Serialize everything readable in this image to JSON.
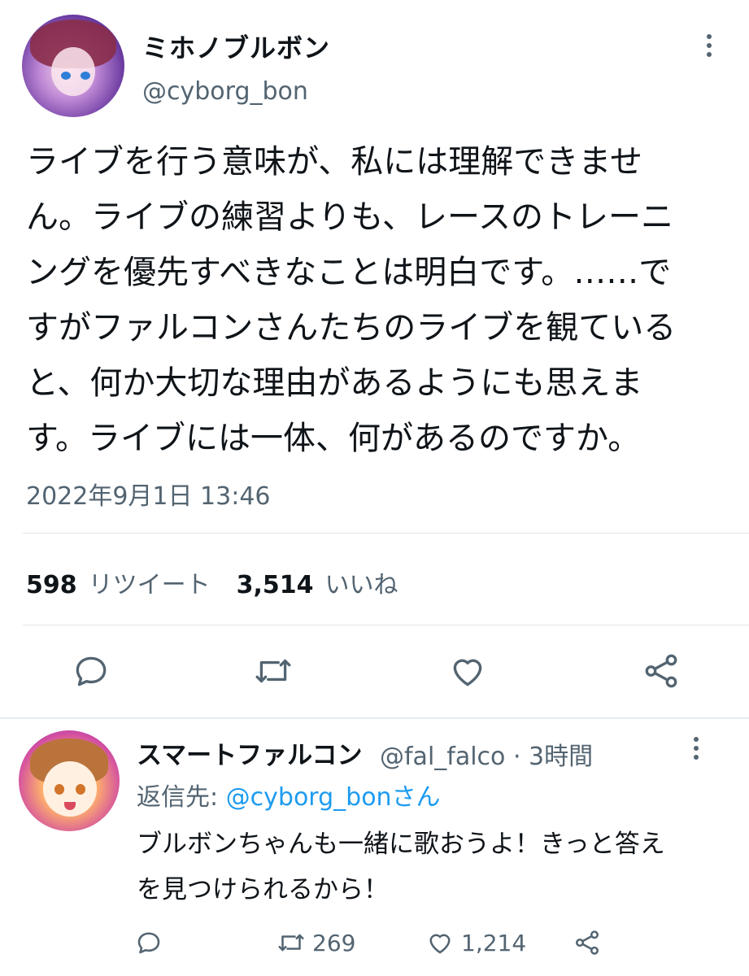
{
  "tweet": {
    "display_name": "ミホノブルボン",
    "handle": "@cyborg_bon",
    "text_lines": [
      "ライブを行う意味が、私には理解できませ",
      "ん。ライブの練習よりも、レースのトレーニ",
      "ングを優先すべきなことは明白です。……で",
      "すがファルコンさんたちのライブを観ている",
      "と、何か大切な理由があるようにも思えま",
      "す。ライブには一体、何があるのですか。"
    ],
    "timestamp": "2022年9月1日 13:46",
    "retweet_count": "598",
    "retweet_label": "リツイート",
    "like_count": "3,514",
    "like_label": "いいね",
    "icons": [
      "more-icon",
      "reply-icon",
      "retweet-icon",
      "like-icon",
      "share-icon"
    ]
  },
  "reply": {
    "display_name": "スマートファルコン",
    "meta": "@fal_falco · 3時間",
    "reply_to_prefix": "返信先: ",
    "reply_to_handle": "@cyborg_bonさん",
    "text_lines": [
      "ブルボンちゃんも一緒に歌おうよ！きっと答え",
      "を見つけられるから！"
    ],
    "retweet_count": "269",
    "like_count": "1,214"
  },
  "colors": {
    "text_primary": "#0f1419",
    "text_secondary": "#536471",
    "link": "#1d9bf0",
    "divider": "#e1e6ea"
  }
}
